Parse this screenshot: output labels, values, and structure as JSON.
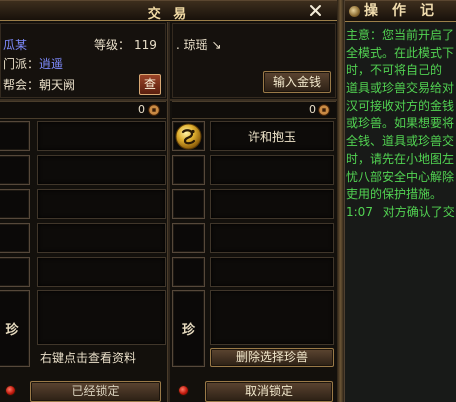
{
  "window": {
    "title": "交 易"
  },
  "self": {
    "name": "瓜某",
    "level_label": "等级：",
    "level": "119",
    "sect_label": "门派：",
    "sect": "逍遥",
    "guild_label": "帮会：",
    "guild": "朝天阙",
    "inspect_label": "查",
    "money": "0",
    "items": [
      {
        "name": ""
      },
      {
        "name": ""
      },
      {
        "name": ""
      },
      {
        "name": ""
      },
      {
        "name": ""
      }
    ],
    "pet_label": "珍",
    "pet_name": "",
    "pet_hint": "右键点击查看资料",
    "lock_label": "已经锁定"
  },
  "partner": {
    "name": ". 琼瑶 ↘",
    "input_money_label": "输入金钱",
    "money": "0",
    "items": [
      {
        "name": "许和抱玉",
        "icon": "gold-medallion-icon"
      },
      {
        "name": ""
      },
      {
        "name": ""
      },
      {
        "name": ""
      },
      {
        "name": ""
      }
    ],
    "pet_label": "珍",
    "pet_name": "",
    "delete_pet_label": "删除选择珍兽",
    "unlock_label": "取消锁定"
  },
  "log": {
    "title": "操作记",
    "lines": [
      "主意：您当前开启了",
      "全模式。在此模式下",
      "时，不可将自己的",
      "道具或珍兽交易给对",
      "汉可接收对方的金钱",
      "或珍兽。如果想要将",
      "全钱、道具或珍兽交",
      "时，请先在小地图左",
      "忧八部安全中心解除",
      "吏用的保护措施。"
    ],
    "latest_time": "1:07",
    "latest_text": "对方确认了交"
  },
  "colors": {
    "player_name": "#7f8cff",
    "log_text": "#52d352",
    "title_text": "#f3dca6",
    "button_border": "#9a7a48",
    "lock_indicator": "#c0180c",
    "item_icon": "#e0b030"
  },
  "icons": {
    "close": "close-icon",
    "money": "copper-coin-icon",
    "log_header": "round-emblem-icon",
    "partner_item_1": "gold-medallion-icon",
    "lock_status": "red-indicator-icon"
  }
}
